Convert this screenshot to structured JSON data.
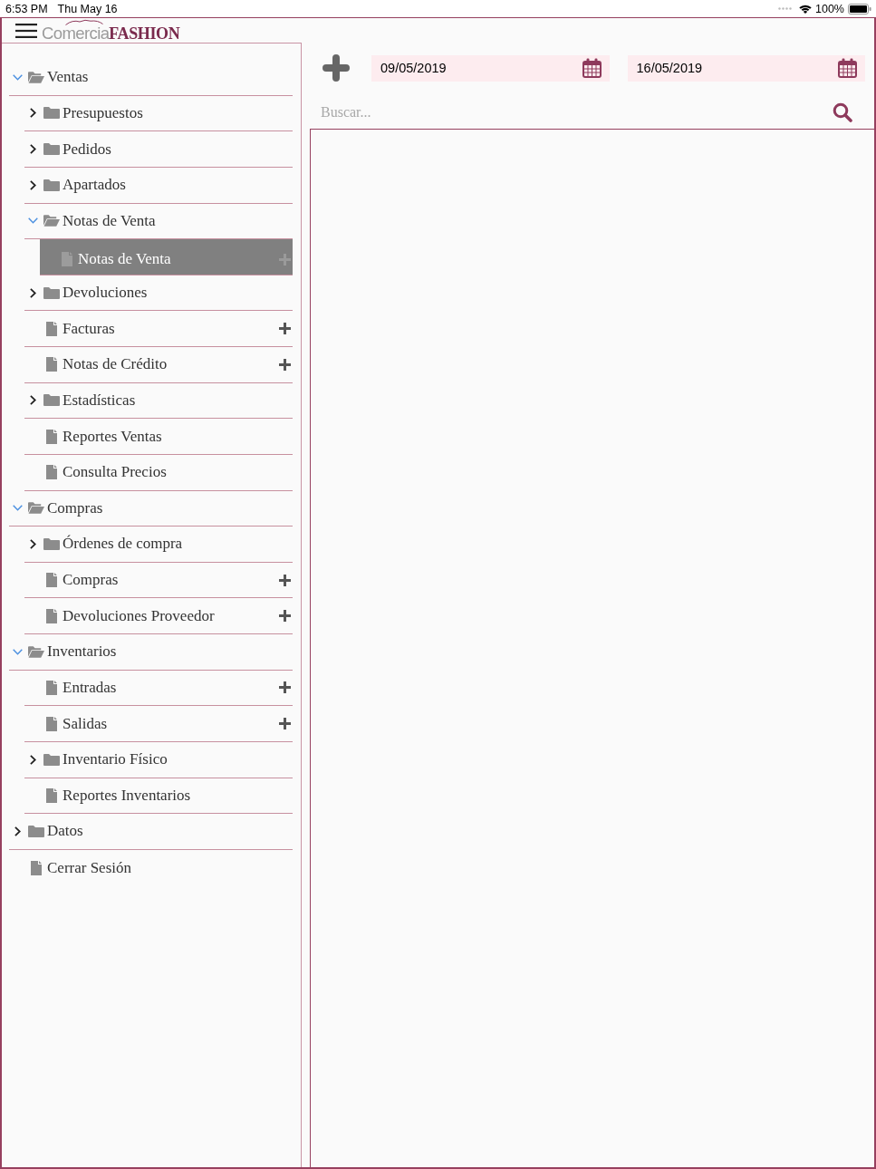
{
  "status_bar": {
    "time": "6:53 PM",
    "date": "Thu May 16",
    "battery": "100%"
  },
  "header": {
    "logo": "Comercia**FASHION**"
  },
  "sidebar": {
    "items": [
      {
        "label": "Ventas",
        "kind": "folder",
        "expanded": true,
        "selected": false,
        "children": [
          {
            "label": "Presupuestos",
            "kind": "folder",
            "expanded": false,
            "selected": false
          },
          {
            "label": "Pedidos",
            "kind": "folder",
            "expanded": false,
            "selected": false
          },
          {
            "label": "Apartados",
            "kind": "folder",
            "expanded": false,
            "selected": false
          },
          {
            "label": "Notas de Venta",
            "kind": "folder",
            "expanded": true,
            "selected": false,
            "children": [
              {
                "label": "Notas de Venta",
                "kind": "document",
                "add_button": true,
                "selected": true
              }
            ]
          },
          {
            "label": "Devoluciones",
            "kind": "folder",
            "expanded": false,
            "selected": false
          },
          {
            "label": "Facturas",
            "kind": "document",
            "add_button": true,
            "selected": false
          },
          {
            "label": "Notas de Crédito",
            "kind": "document",
            "add_button": true,
            "selected": false
          },
          {
            "label": "Estadísticas",
            "kind": "folder",
            "expanded": false,
            "selected": false
          },
          {
            "label": "Reportes Ventas",
            "kind": "document",
            "add_button": false,
            "selected": false
          },
          {
            "label": "Consulta Precios",
            "kind": "document",
            "add_button": false,
            "selected": false
          }
        ]
      },
      {
        "label": "Compras",
        "kind": "folder",
        "expanded": true,
        "selected": false,
        "children": [
          {
            "label": "Órdenes de compra",
            "kind": "folder",
            "expanded": false,
            "selected": false
          },
          {
            "label": "Compras",
            "kind": "document",
            "add_button": true,
            "selected": false
          },
          {
            "label": "Devoluciones Proveedor",
            "kind": "document",
            "add_button": true,
            "selected": false
          }
        ]
      },
      {
        "label": "Inventarios",
        "kind": "folder",
        "expanded": true,
        "selected": false,
        "children": [
          {
            "label": "Entradas",
            "kind": "document",
            "add_button": true,
            "selected": false
          },
          {
            "label": "Salidas",
            "kind": "document",
            "add_button": true,
            "selected": false
          },
          {
            "label": "Inventario Físico",
            "kind": "folder",
            "expanded": false,
            "selected": false
          },
          {
            "label": "Reportes Inventarios",
            "kind": "document",
            "add_button": false,
            "selected": false
          }
        ]
      },
      {
        "label": "Datos",
        "kind": "folder",
        "expanded": false,
        "selected": false
      },
      {
        "label": "Cerrar Sesión",
        "kind": "document",
        "add_button": false,
        "selected": false
      }
    ]
  },
  "toolbar": {
    "date_from": "09/05/2019",
    "date_to": "16/05/2019"
  },
  "search": {
    "placeholder": "Buscar..."
  }
}
